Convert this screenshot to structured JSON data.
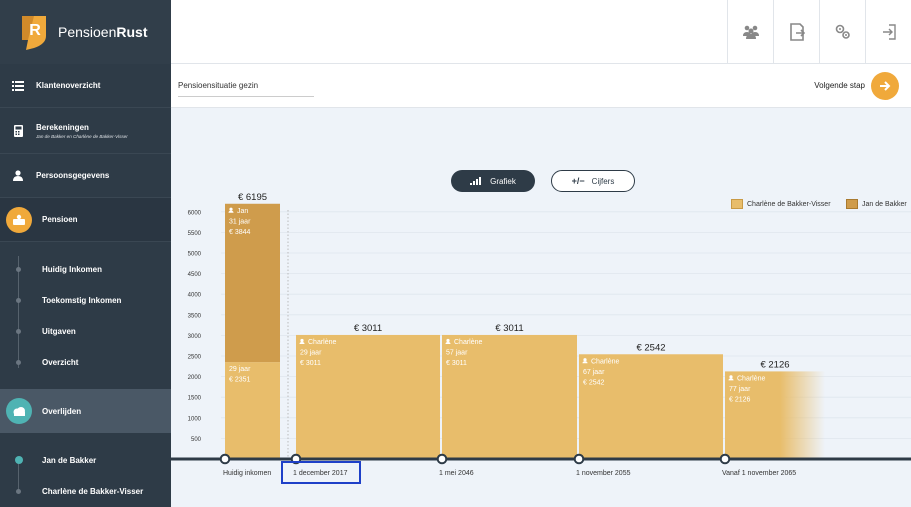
{
  "brand": {
    "name_regular": "Pensioen",
    "name_bold": "Rust"
  },
  "nav": {
    "klanten": "Klantenoverzicht",
    "berekeningen": "Berekeningen",
    "berekeningen_sub": "Jan de Bakker en Charlène de Bakker-Visser",
    "persoons": "Persoonsgegevens",
    "pensioen": "Pensioen",
    "pensioen_sub": [
      "Huidig Inkomen",
      "Toekomstig Inkomen",
      "Uitgaven",
      "Overzicht"
    ],
    "overlijden": "Overlijden",
    "overlijden_sub": [
      "Jan de Bakker",
      "Charlène de Bakker-Visser"
    ]
  },
  "header": {
    "breadcrumb": "Pensioensituatie gezin",
    "next_label": "Volgende stap"
  },
  "toggle": {
    "grafiek": "Grafiek",
    "cijfers": "Cijfers"
  },
  "legend": [
    "Charlène de Bakker-Visser",
    "Jan de Bakker"
  ],
  "colors": {
    "charlene": "#e8bd6b",
    "jan": "#cf9c4c",
    "accent": "#f0a93b",
    "sidebar": "#2e3b47",
    "highlight": "#1e40c8"
  },
  "chart_data": {
    "type": "bar",
    "yticks": [
      500,
      1000,
      1500,
      2000,
      2500,
      3000,
      3500,
      4000,
      4500,
      5000,
      5500,
      6000
    ],
    "ylim": [
      0,
      6000
    ],
    "periods": [
      {
        "label": "Huidig inkomen",
        "total": "€ 6195",
        "value": 6195,
        "segments": [
          {
            "person": "Charlène",
            "value": 2351,
            "lines": [
              "29 jaar",
              "€  2351"
            ]
          },
          {
            "person": "Jan",
            "value": 3844,
            "lines": [
              "Jan",
              "31 jaar",
              "€  3844"
            ]
          }
        ]
      },
      {
        "label": "1 december 2017",
        "total": "€ 3011",
        "value": 3011,
        "segments": [
          {
            "person": "Charlène",
            "value": 3011,
            "lines": [
              "Charlène",
              "29 jaar",
              "€  3011"
            ]
          }
        ]
      },
      {
        "label": "1 mei 2046",
        "total": "€ 3011",
        "value": 3011,
        "segments": [
          {
            "person": "Charlène",
            "value": 3011,
            "lines": [
              "Charlène",
              "57 jaar",
              "€  3011"
            ]
          }
        ]
      },
      {
        "label": "1 november 2055",
        "total": "€ 2542",
        "value": 2542,
        "segments": [
          {
            "person": "Charlène",
            "value": 2542,
            "lines": [
              "Charlène",
              "67 jaar",
              "€  2542"
            ]
          }
        ]
      },
      {
        "label": "Vanaf 1 november 2065",
        "total": "€ 2126",
        "value": 2126,
        "segments": [
          {
            "person": "Charlène",
            "value": 2126,
            "lines": [
              "Charlène",
              "77 jaar",
              "€  2126"
            ]
          }
        ]
      }
    ]
  }
}
